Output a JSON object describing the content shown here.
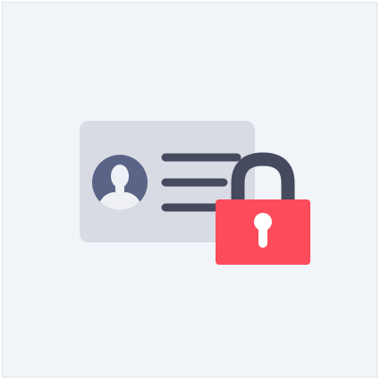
{
  "illustration": {
    "colors": {
      "background": "#f1f4f8",
      "card": "#d9dbe4",
      "avatar_circle": "#5b6487",
      "avatar_silhouette": "#eef0f5",
      "lines": "#454a5f",
      "shackle": "#454a5f",
      "lock_body": "#fc4b5a",
      "keyhole": "#ffffff"
    },
    "icons": [
      "id-card-icon",
      "user-avatar-icon",
      "padlock-icon",
      "keyhole-icon"
    ]
  }
}
